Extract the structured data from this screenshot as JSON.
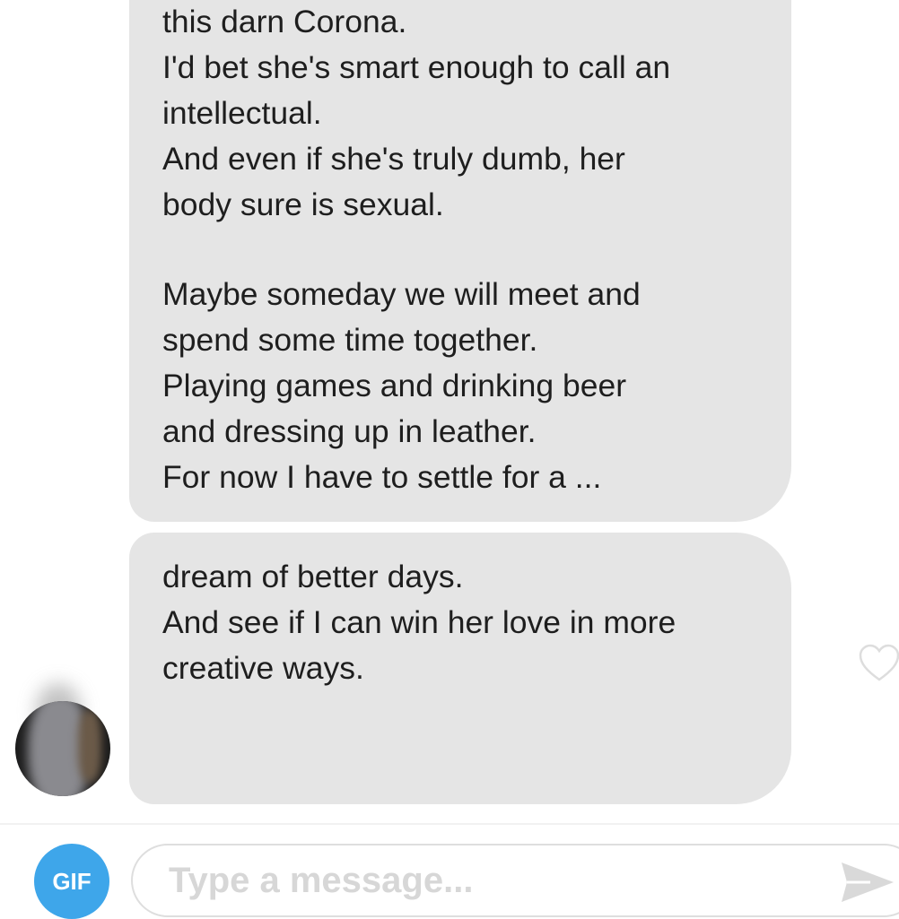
{
  "messages": [
    {
      "lines": [
        "this darn Corona.",
        "I'd bet she's smart enough to call an",
        "intellectual.",
        "And even if she's truly dumb, her",
        "body sure is sexual.",
        "",
        "Maybe someday we will meet and",
        "spend some time together.",
        "Playing games and drinking beer",
        "and dressing up in leather.",
        "For now I have to settle for a ..."
      ]
    },
    {
      "lines": [
        "dream of better days.",
        "And see if I can win her love in more",
        "creative ways."
      ]
    }
  ],
  "composer": {
    "gif_label": "GIF",
    "placeholder": "Type a message...",
    "send_icon": "send-icon"
  },
  "icons": {
    "like": "heart-outline-icon",
    "avatar": "blurred-profile-photo"
  },
  "colors": {
    "bubble": "#e5e5e5",
    "gif_button": "#3ea6ea",
    "placeholder": "#d7d7d7",
    "send_icon": "#d9d9d9",
    "heart_outline": "#dddddd"
  }
}
